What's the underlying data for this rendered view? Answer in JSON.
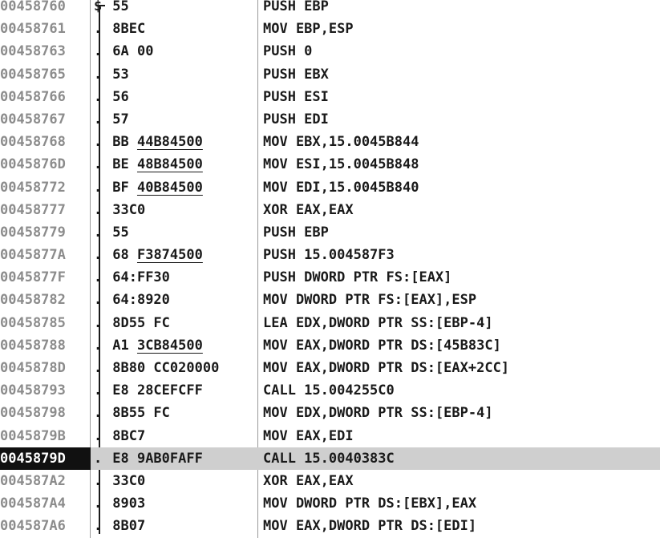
{
  "rows": [
    {
      "addr": "00458760",
      "marker": "$",
      "opcode": "55",
      "operand": "",
      "instr": "PUSH EBP",
      "selected": false
    },
    {
      "addr": "00458761",
      "marker": ".",
      "opcode": "8BEC",
      "operand": "",
      "instr": "MOV EBP,ESP",
      "selected": false
    },
    {
      "addr": "00458763",
      "marker": ".",
      "opcode": "6A 00",
      "operand": "",
      "instr": "PUSH 0",
      "selected": false
    },
    {
      "addr": "00458765",
      "marker": ".",
      "opcode": "53",
      "operand": "",
      "instr": "PUSH EBX",
      "selected": false
    },
    {
      "addr": "00458766",
      "marker": ".",
      "opcode": "56",
      "operand": "",
      "instr": "PUSH ESI",
      "selected": false
    },
    {
      "addr": "00458767",
      "marker": ".",
      "opcode": "57",
      "operand": "",
      "instr": "PUSH EDI",
      "selected": false
    },
    {
      "addr": "00458768",
      "marker": ".",
      "opcode": "BB ",
      "operand": "44B84500",
      "instr": "MOV EBX,15.0045B844",
      "selected": false
    },
    {
      "addr": "0045876D",
      "marker": ".",
      "opcode": "BE ",
      "operand": "48B84500",
      "instr": "MOV ESI,15.0045B848",
      "selected": false
    },
    {
      "addr": "00458772",
      "marker": ".",
      "opcode": "BF ",
      "operand": "40B84500",
      "instr": "MOV EDI,15.0045B840",
      "selected": false
    },
    {
      "addr": "00458777",
      "marker": ".",
      "opcode": "33C0",
      "operand": "",
      "instr": "XOR EAX,EAX",
      "selected": false
    },
    {
      "addr": "00458779",
      "marker": ".",
      "opcode": "55",
      "operand": "",
      "instr": "PUSH EBP",
      "selected": false
    },
    {
      "addr": "0045877A",
      "marker": ".",
      "opcode": "68 ",
      "operand": "F3874500",
      "instr": "PUSH 15.004587F3",
      "selected": false
    },
    {
      "addr": "0045877F",
      "marker": ".",
      "opcode": "64:FF30",
      "operand": "",
      "instr": "PUSH DWORD PTR FS:[EAX]",
      "selected": false
    },
    {
      "addr": "00458782",
      "marker": ".",
      "opcode": "64:8920",
      "operand": "",
      "instr": "MOV DWORD PTR FS:[EAX],ESP",
      "selected": false
    },
    {
      "addr": "00458785",
      "marker": ".",
      "opcode": "8D55 FC",
      "operand": "",
      "instr": "LEA EDX,DWORD PTR SS:[EBP-4]",
      "selected": false
    },
    {
      "addr": "00458788",
      "marker": ".",
      "opcode": "A1 ",
      "operand": "3CB84500",
      "instr": "MOV EAX,DWORD PTR DS:[45B83C]",
      "selected": false
    },
    {
      "addr": "0045878D",
      "marker": ".",
      "opcode": "8B80 CC020000",
      "operand": "",
      "instr": "MOV EAX,DWORD PTR DS:[EAX+2CC]",
      "selected": false
    },
    {
      "addr": "00458793",
      "marker": ".",
      "opcode": "E8 28CEFCFF",
      "operand": "",
      "instr": "CALL 15.004255C0",
      "selected": false
    },
    {
      "addr": "00458798",
      "marker": ".",
      "opcode": "8B55 FC",
      "operand": "",
      "instr": "MOV EDX,DWORD PTR SS:[EBP-4]",
      "selected": false
    },
    {
      "addr": "0045879B",
      "marker": ".",
      "opcode": "8BC7",
      "operand": "",
      "instr": "MOV EAX,EDI",
      "selected": false
    },
    {
      "addr": "0045879D",
      "marker": ".",
      "opcode": "E8 9AB0FAFF",
      "operand": "",
      "instr": "CALL 15.0040383C",
      "selected": true
    },
    {
      "addr": "004587A2",
      "marker": ".",
      "opcode": "33C0",
      "operand": "",
      "instr": "XOR EAX,EAX",
      "selected": false
    },
    {
      "addr": "004587A4",
      "marker": ".",
      "opcode": "8903",
      "operand": "",
      "instr": "MOV DWORD PTR DS:[EBX],EAX",
      "selected": false
    },
    {
      "addr": "004587A6",
      "marker": ".",
      "opcode": "8B07",
      "operand": "",
      "instr": "MOV EAX,DWORD PTR DS:[EDI]",
      "selected": false
    }
  ],
  "colors": {
    "address_text": "#8c8c8c",
    "selected_row_bg": "#cfcfcf",
    "selected_address_bg": "#111111",
    "selected_address_text": "#ffffff"
  }
}
